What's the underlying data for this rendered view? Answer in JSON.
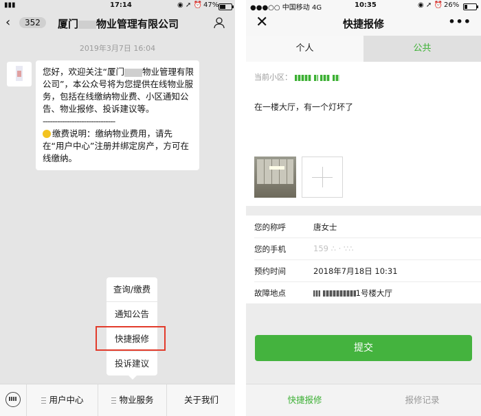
{
  "left": {
    "status": {
      "time": "17:14",
      "battery": "47%",
      "battery_fraction": 0.47
    },
    "nav": {
      "back_count": "352",
      "title_prefix": "厦门",
      "title_suffix": "物业管理有限公司"
    },
    "chat": {
      "date": "2019年3月7日 16:04",
      "msg_part1": "您好，欢迎关注“厦门",
      "msg_part2": "物业管理有限公司”，本公众号将为您提供在线物业服务，包括在线缴纳物业费、小区通知公告、物业报修、投诉建议等。",
      "separator": "------------------------------",
      "fee_note": "缴费说明：缴纳物业费用，请先在“用户中心”注册并绑定房产，方可在线缴纳。"
    },
    "popup": [
      "查询/缴费",
      "通知公告",
      "快捷报修",
      "投诉建议"
    ],
    "bottom_menu": [
      "用户中心",
      "物业服务",
      "关于我们"
    ]
  },
  "right": {
    "status": {
      "carrier": "●●●○○ 中国移动  4G",
      "time": "10:35",
      "battery": "26%",
      "battery_fraction": 0.26
    },
    "nav": {
      "title": "快捷报修",
      "close": "✕",
      "more": "•••"
    },
    "tabs": [
      "个人",
      "公共"
    ],
    "area_label": "当前小区：",
    "description": "在一楼大厅，有一个灯坏了",
    "form": {
      "name_label": "您的称呼",
      "name_value": "唐女士",
      "phone_label": "您的手机",
      "phone_value": "159",
      "time_label": "预约时间",
      "time_value": "2018年7月18日 10:31",
      "location_label": "故障地点",
      "location_value": "1号楼大厅"
    },
    "submit": "提交",
    "bottom_tabs": [
      "快捷报修",
      "报修记录"
    ]
  }
}
